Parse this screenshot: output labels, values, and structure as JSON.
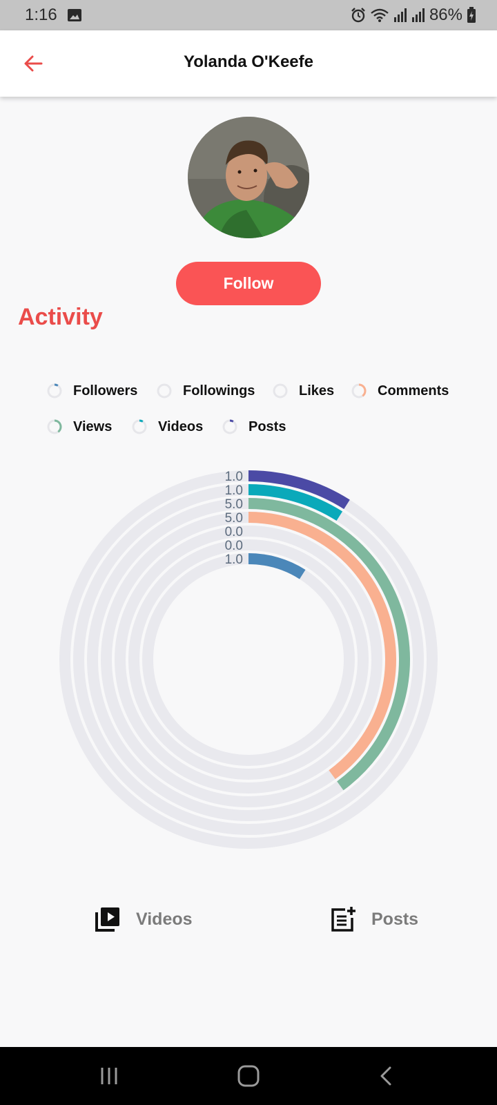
{
  "status_bar": {
    "time": "1:16",
    "battery": "86%",
    "icons": [
      "gallery-icon",
      "alarm-icon",
      "wifi-icon",
      "signal-icon",
      "signal-icon",
      "battery-charging-icon"
    ]
  },
  "app_bar": {
    "title": "Yolanda O'Keefe",
    "back_icon": "arrow-left-icon",
    "accent": "#ea4c4a"
  },
  "profile": {
    "follow_label": "Follow",
    "follow_color": "#fa5455"
  },
  "activity": {
    "title": "Activity",
    "legend": [
      {
        "label": "Followers",
        "color": "#4b87b9"
      },
      {
        "label": "Followings",
        "color": "#c0c4cc"
      },
      {
        "label": "Likes",
        "color": "#c0c4cc"
      },
      {
        "label": "Comments",
        "color": "#f9b090"
      },
      {
        "label": "Views",
        "color": "#7fb89e"
      },
      {
        "label": "Videos",
        "color": "#0aa9ba"
      },
      {
        "label": "Posts",
        "color": "#4b4aa5"
      }
    ]
  },
  "chart_data": {
    "type": "radial-bar",
    "series_max": 100,
    "track_color": "#e9e9ee",
    "series": [
      {
        "name": "Posts",
        "value": 1.0,
        "label": "1.0",
        "color": "#4b4aa5",
        "fraction": 0.09
      },
      {
        "name": "Videos",
        "value": 1.0,
        "label": "1.0",
        "color": "#0aa9ba",
        "fraction": 0.09
      },
      {
        "name": "Views",
        "value": 5.0,
        "label": "5.0",
        "color": "#7fb89e",
        "fraction": 0.4
      },
      {
        "name": "Comments",
        "value": 5.0,
        "label": "5.0",
        "color": "#f9b090",
        "fraction": 0.4
      },
      {
        "name": "Likes",
        "value": 0.0,
        "label": "0.0",
        "color": "#c0c4cc",
        "fraction": 0
      },
      {
        "name": "Followings",
        "value": 0.0,
        "label": "0.0",
        "color": "#c0c4cc",
        "fraction": 0
      },
      {
        "name": "Followers",
        "value": 1.0,
        "label": "1.0",
        "color": "#4b87b9",
        "fraction": 0.09
      }
    ]
  },
  "tabs": [
    {
      "label": "Videos",
      "icon": "video-library-icon"
    },
    {
      "label": "Posts",
      "icon": "post-add-icon"
    }
  ],
  "nav_bar": {
    "icons": [
      "recents-icon",
      "home-icon",
      "back-icon"
    ]
  }
}
